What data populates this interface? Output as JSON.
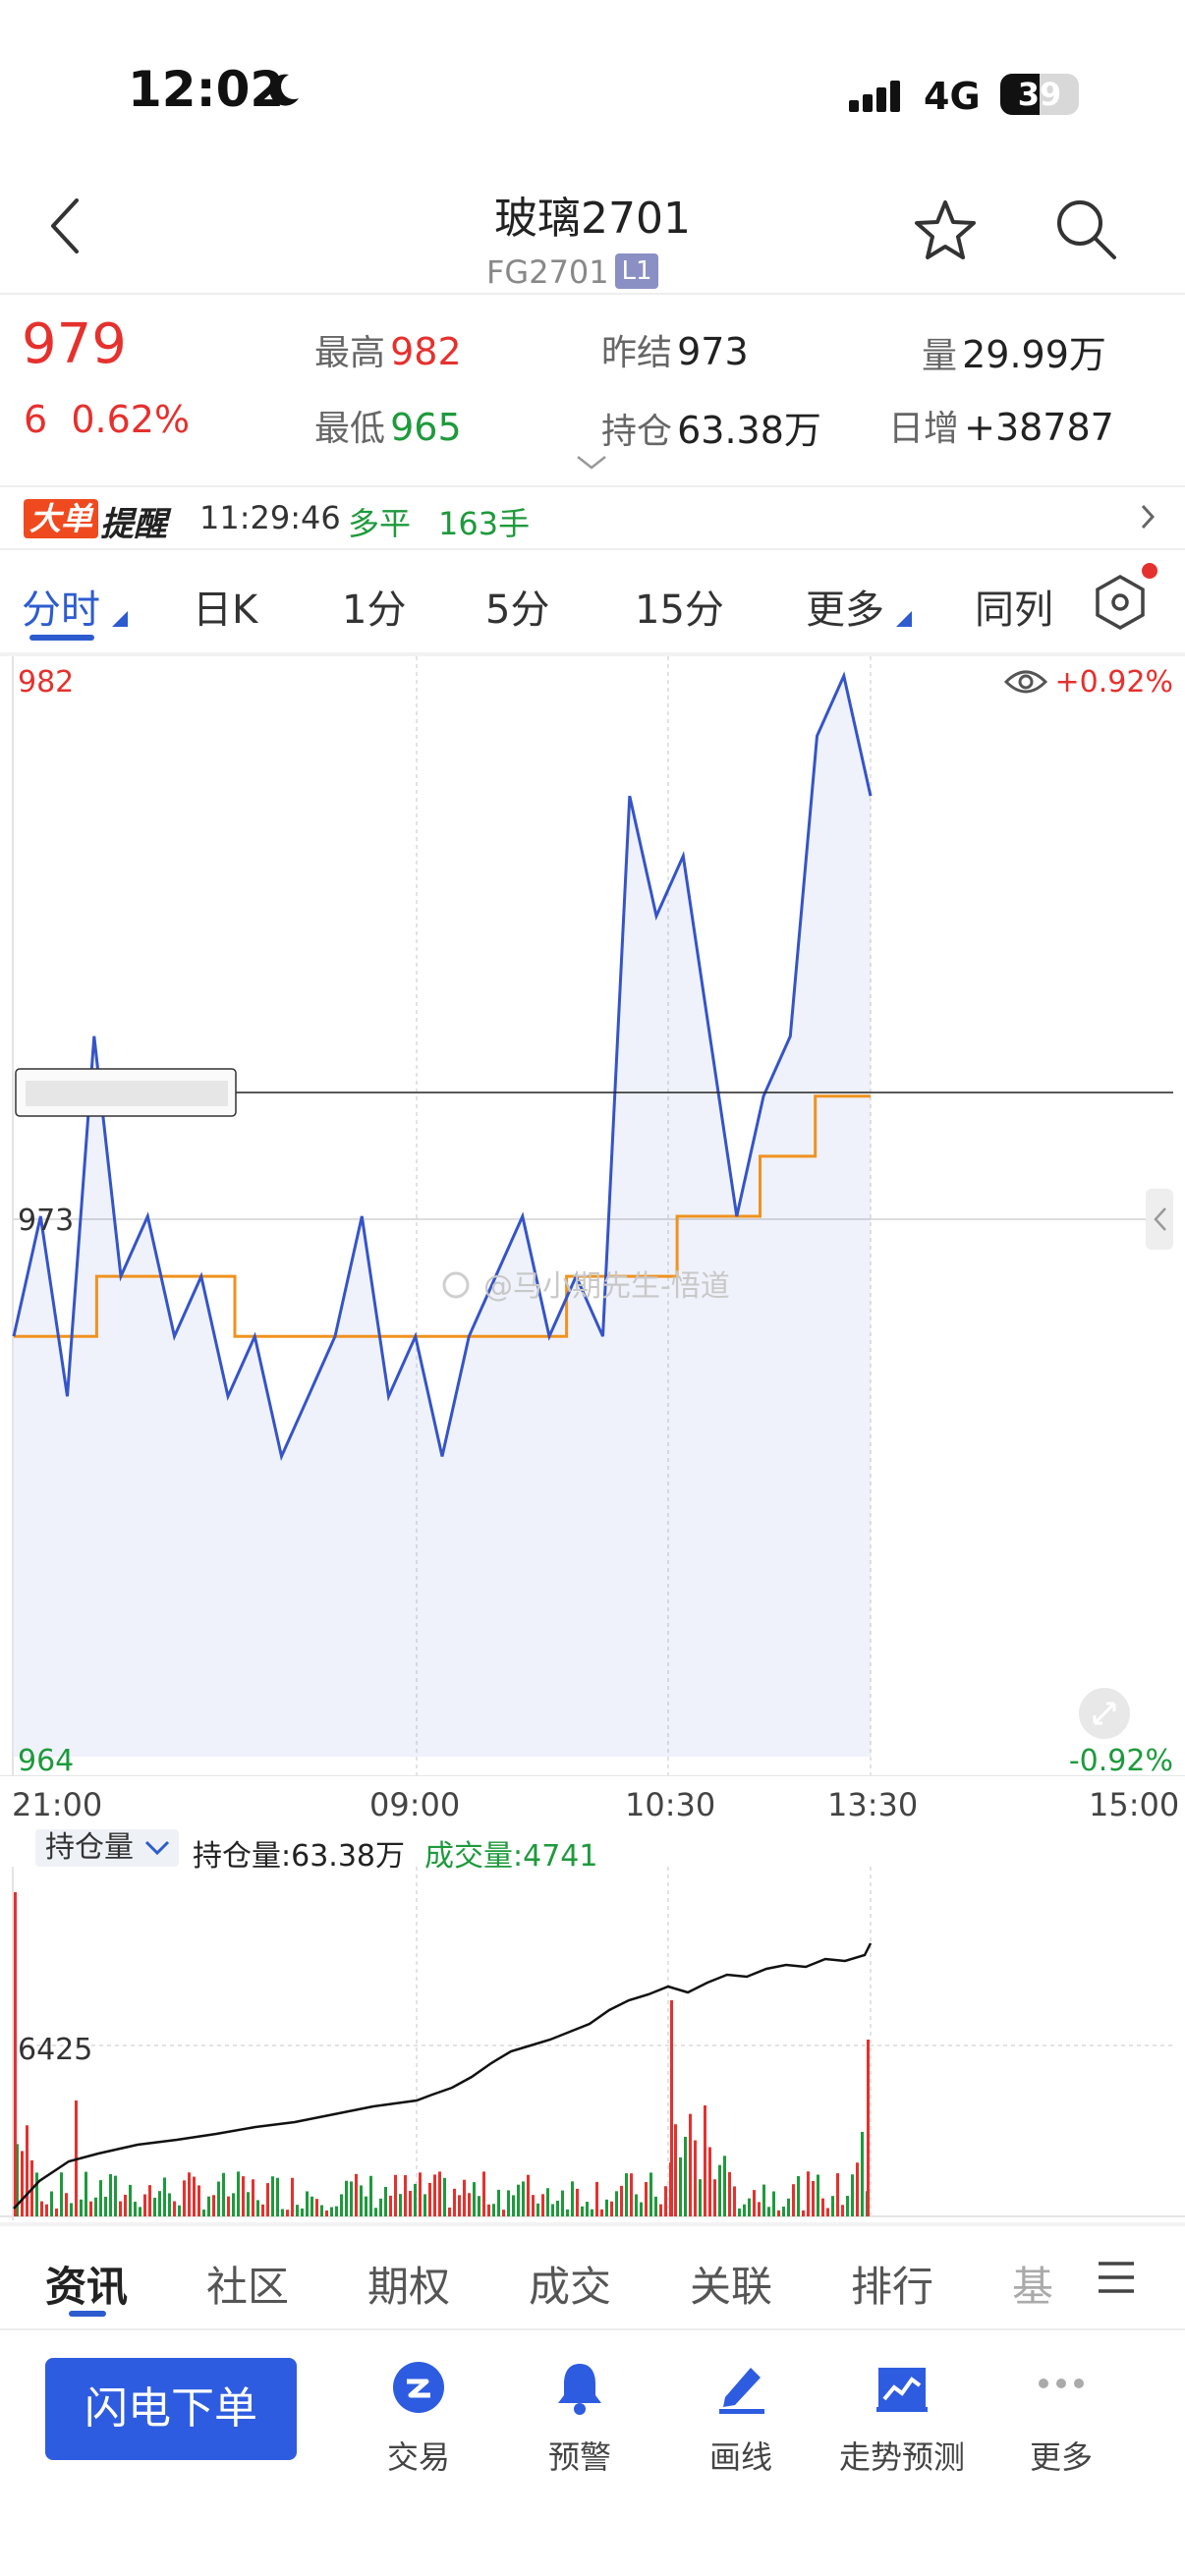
{
  "status_bar": {
    "time": "12:02",
    "network": "4G",
    "battery": "39"
  },
  "header": {
    "title": "玻璃2701",
    "code": "FG2701",
    "level": "L1"
  },
  "quote": {
    "price": "979",
    "change": "6",
    "change_pct": "0.62%",
    "high_label": "最高",
    "high": "982",
    "low_label": "最低",
    "low": "965",
    "prev_settle_label": "昨结",
    "prev_settle": "973",
    "open_interest_label": "持仓",
    "open_interest": "63.38万",
    "volume_label": "量",
    "volume": "29.99万",
    "daily_inc_label": "日增",
    "daily_inc": "+38787"
  },
  "alert": {
    "badge": "大单",
    "suffix": "提醒",
    "time": "11:29:46",
    "side": "多平",
    "qty": "163手"
  },
  "chart_tabs": [
    "分时",
    "日K",
    "1分",
    "5分",
    "15分",
    "更多",
    "同列"
  ],
  "chart": {
    "y_top": "982",
    "y_mid": "973",
    "y_bottom": "964",
    "pct_top": "+0.92%",
    "pct_bottom": "-0.92%",
    "times": [
      "21:00",
      "09:00",
      "10:30",
      "13:30",
      "15:00"
    ],
    "watermark": "@马小期先生-悟道",
    "colors": {
      "price_line": "#3554c8",
      "avg_line": "#f0921e",
      "up": "#e5312e",
      "down": "#1e9a3c"
    }
  },
  "volume_panel": {
    "selector": "持仓量",
    "oi_text": "持仓量:63.38万",
    "vol_text": "成交量:4741",
    "axis_label": "6425"
  },
  "chart_data": {
    "type": "line",
    "x_labels": [
      "21:00",
      "09:00",
      "10:30",
      "13:30",
      "15:00"
    ],
    "ylim": [
      964,
      982
    ],
    "series": [
      {
        "values": [
          971,
          973,
          970,
          976,
          972,
          973,
          971,
          972,
          970,
          971,
          969,
          970,
          971,
          973,
          970,
          971,
          969,
          971,
          972,
          973,
          971,
          972,
          971,
          980,
          978,
          979,
          976,
          973,
          975,
          976,
          981,
          982,
          980
        ]
      },
      {
        "values": [
          971,
          971,
          971,
          972,
          972,
          972,
          972,
          972,
          971,
          971,
          971,
          971,
          971,
          971,
          971,
          971,
          971,
          971,
          971,
          971,
          972,
          972,
          972,
          972,
          973,
          973,
          973,
          974,
          974,
          975,
          975,
          975
        ]
      }
    ]
  }
}
